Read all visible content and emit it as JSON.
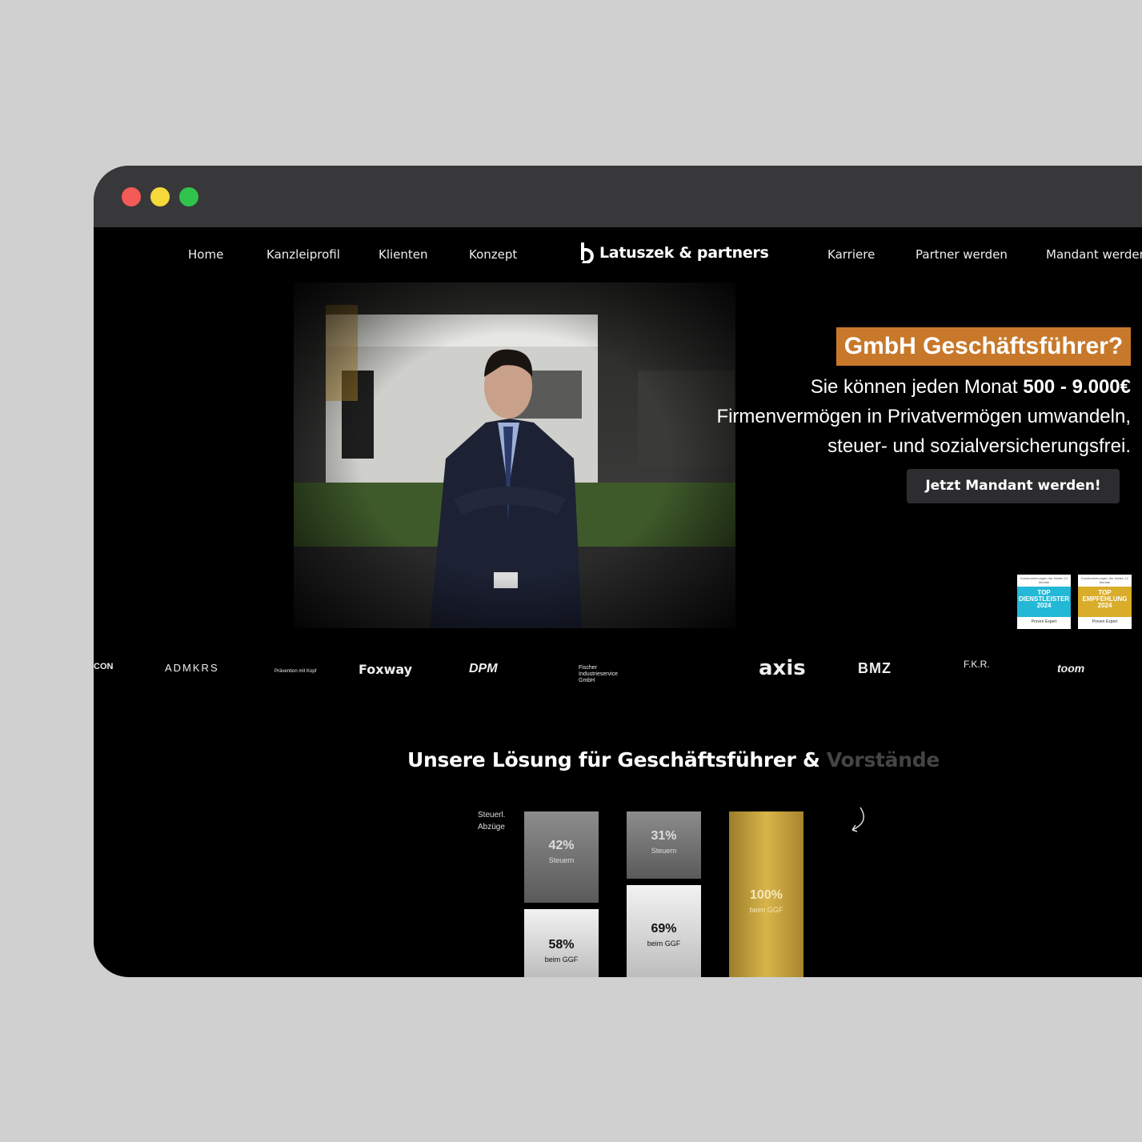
{
  "nav": {
    "left": [
      "Home",
      "Kanzleiprofil",
      "Klienten",
      "Konzept"
    ],
    "brand": "Latuszek & partners",
    "right": [
      "Karriere",
      "Partner werden",
      "Mandant werden"
    ]
  },
  "hero": {
    "headline": "GmbH Geschäftsführer?",
    "line1_prefix": "Sie können jeden Monat ",
    "line1_bold": "500 - 9.000€",
    "line2": "Firmenvermögen in Privatvermögen umwandeln,",
    "line3": "steuer- und sozialversicherungsfrei.",
    "cta": "Jetzt Mandant werden!"
  },
  "badges": [
    {
      "top": "Kundenmeinungen der letzten 12 Monate",
      "title": "TOP DIENSTLEISTER 2024",
      "footer": "Proven Expert",
      "color": "#22b8d6"
    },
    {
      "top": "Kundenmeinungen der letzten 12 Monate",
      "title": "TOP EMPFEHLUNG 2024",
      "footer": "Proven Expert",
      "color": "#d9ad2a"
    }
  ],
  "client_logos": [
    "CON",
    "ADMKRS",
    "Prävention mit Kopf",
    "Foxway",
    "DPM",
    "Fischer Industrieservice GmbH",
    "axis",
    "BMZ",
    "F.K.R.",
    "toom"
  ],
  "section": {
    "title_main": "Unsere Lösung für Geschäftsführer & ",
    "title_fade": "Vorstände"
  },
  "chart_data": {
    "type": "bar",
    "label": "Steuerl. Abzüge",
    "columns": [
      {
        "segments": [
          {
            "value": "42%",
            "label": "Steuern"
          },
          {
            "value": "58%",
            "label": "beim GGF"
          }
        ]
      },
      {
        "segments": [
          {
            "value": "31%",
            "label": "Steuern"
          },
          {
            "value": "69%",
            "label": "beim GGF"
          }
        ]
      },
      {
        "segments": [
          {
            "value": "100%",
            "label": "beim GGF"
          }
        ]
      }
    ]
  }
}
